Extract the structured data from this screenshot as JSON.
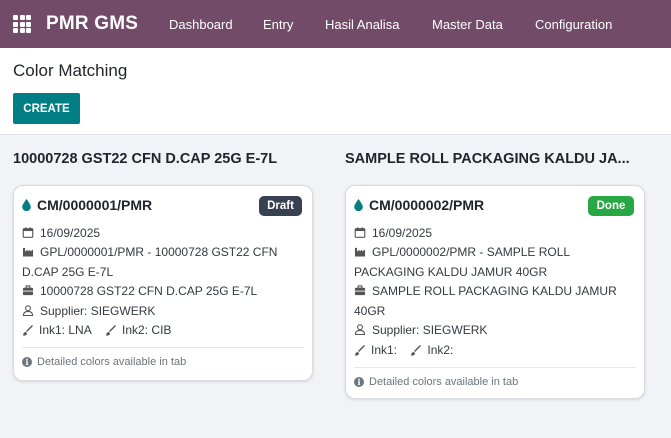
{
  "nav": {
    "brand": "PMR GMS",
    "items": [
      "Dashboard",
      "Entry",
      "Hasil Analisa",
      "Master Data",
      "Configuration"
    ]
  },
  "page": {
    "title": "Color Matching",
    "create_label": "CREATE"
  },
  "groups": [
    {
      "title": "10000728 GST22 CFN D.CAP 25G E-7L",
      "card": {
        "ref": "CM/0000001/PMR",
        "status": "Draft",
        "date": "16/09/2025",
        "gpl": "GPL/0000001/PMR - 10000728 GST22 CFN D.CAP 25G E-7L",
        "product": "10000728 GST22 CFN D.CAP 25G E-7L",
        "supplier": "Supplier: SIEGWERK",
        "ink1": "Ink1: LNA",
        "ink2": "Ink2: CIB",
        "note": "Detailed colors available in tab"
      }
    },
    {
      "title": "SAMPLE ROLL PACKAGING KALDU JA...",
      "card": {
        "ref": "CM/0000002/PMR",
        "status": "Done",
        "date": "16/09/2025",
        "gpl": "GPL/0000002/PMR - SAMPLE ROLL PACKAGING KALDU JAMUR 40GR",
        "product": "SAMPLE ROLL PACKAGING KALDU JAMUR 40GR",
        "supplier": "Supplier: SIEGWERK",
        "ink1": "Ink1:",
        "ink2": "Ink2:",
        "note": "Detailed colors available in tab"
      }
    }
  ],
  "colors": {
    "navbar": "#714b67",
    "primary_button": "#017e84",
    "draft_badge": "#374151",
    "done_badge": "#28a745",
    "drop_icon": "#017e84"
  },
  "icons": [
    "apps-grid-icon",
    "drop-icon",
    "calendar-icon",
    "factory-icon",
    "briefcase-icon",
    "user-icon",
    "brush-icon",
    "info-icon"
  ]
}
